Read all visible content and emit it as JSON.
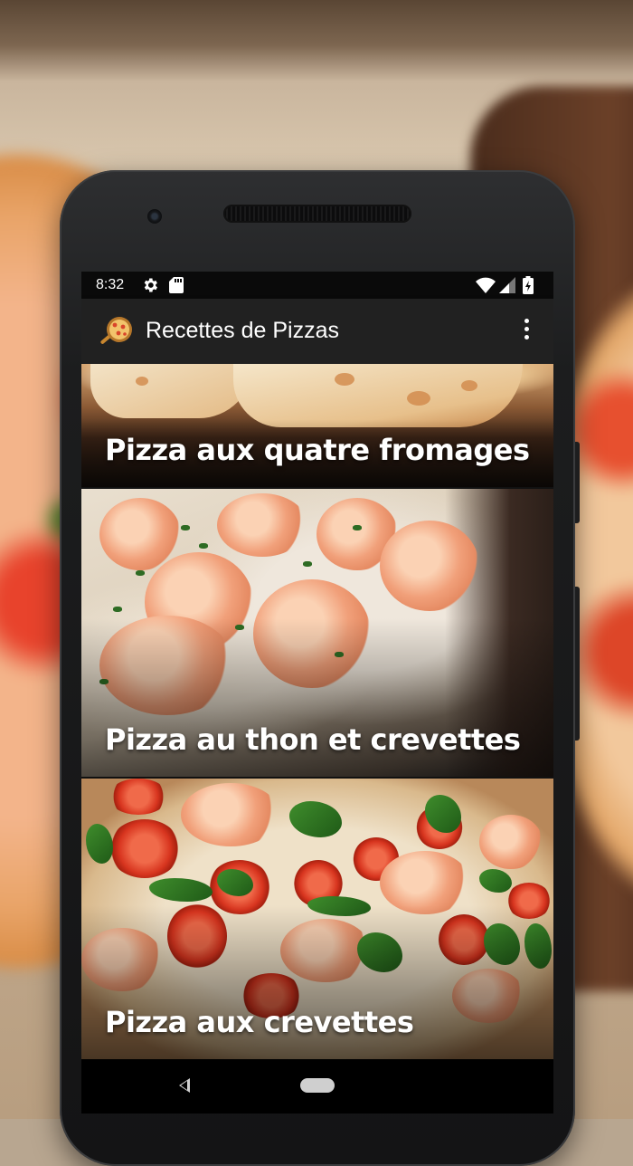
{
  "status_bar": {
    "time": "8:32",
    "icons": [
      "gear-icon",
      "sd-card-icon",
      "wifi-icon",
      "cell-signal-icon",
      "battery-charging-icon"
    ]
  },
  "app_bar": {
    "title": "Recettes de Pizzas",
    "logo_icon": "pizza-logo-icon",
    "menu_icon": "more-vert-icon"
  },
  "recipes": [
    {
      "label": "Pizza aux quatre fromages"
    },
    {
      "label": "Pizza au thon et crevettes"
    },
    {
      "label": "Pizza aux crevettes"
    }
  ],
  "nav_bar": {
    "icons": [
      "back-icon",
      "home-icon"
    ]
  },
  "colors": {
    "app_bar": "#212121",
    "status_bar": "#0a0a0a",
    "nav_bar": "#000000",
    "text": "#ffffff"
  }
}
